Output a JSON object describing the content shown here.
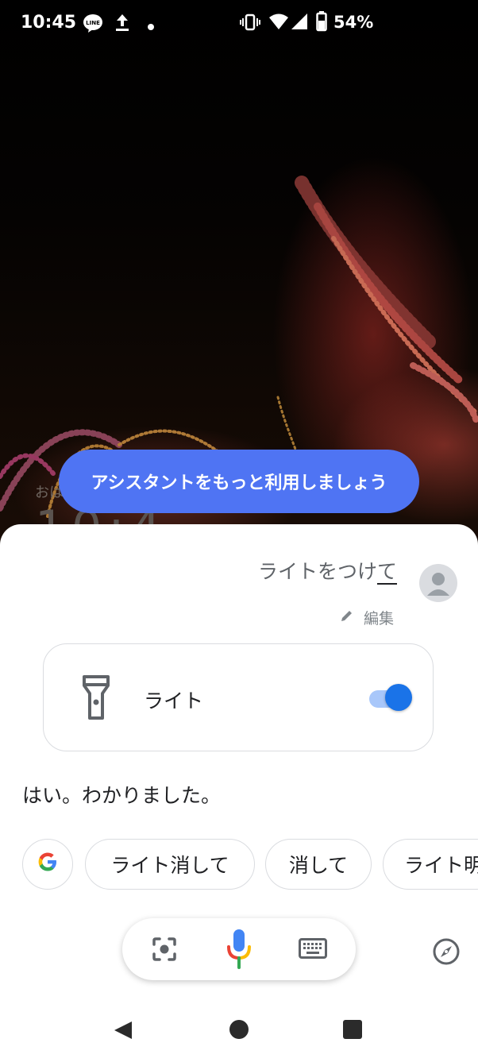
{
  "status_bar": {
    "time": "10:45",
    "battery": "54%",
    "icons": [
      "line-icon",
      "upload-icon",
      "dot-icon",
      "vibrate-icon",
      "wifi-icon",
      "signal-icon",
      "battery-icon"
    ]
  },
  "lockscreen": {
    "greeting_partial": "おは",
    "clock_partial": "10:4"
  },
  "promo": {
    "label": "アシスタントをもっと利用しましょう"
  },
  "assistant": {
    "query_main": "ライトをつけ",
    "query_last": "て",
    "edit_label": "編集",
    "light_card": {
      "label": "ライト",
      "toggle_on": true
    },
    "reply": "はい。わかりました。",
    "chips": [
      "ライト消して",
      "消して",
      "ライト明"
    ],
    "colors": {
      "accent": "#1a73e8",
      "promo": "#4f74f3"
    }
  }
}
